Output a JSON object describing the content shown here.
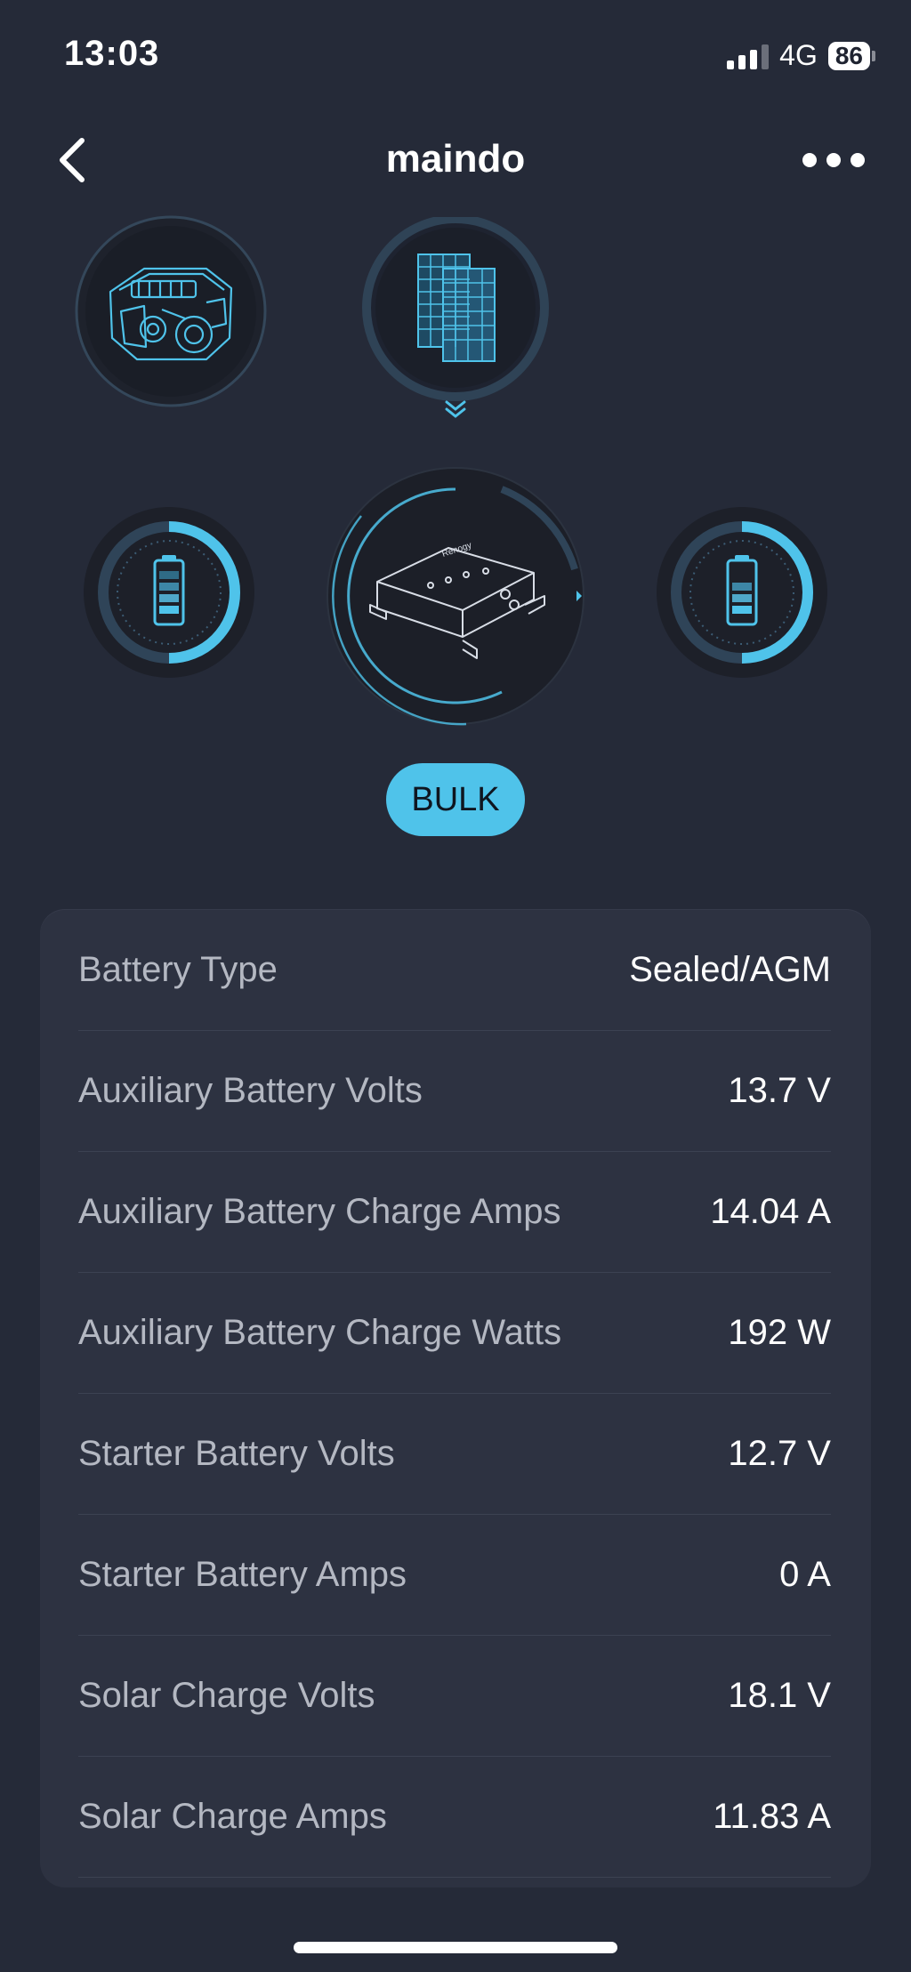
{
  "status_bar": {
    "time": "13:03",
    "network": "4G",
    "battery_level": "86"
  },
  "nav": {
    "title": "maindo"
  },
  "diagram": {
    "engine_icon": "engine-icon",
    "solar_icon": "solar-panel-icon",
    "charger_icon": "dc-dc-charger-icon",
    "aux_battery_icon": "battery-icon",
    "starter_battery_icon": "battery-icon",
    "accent_color": "#4fc3ea"
  },
  "charge_stage": "BULK",
  "info": {
    "rows": [
      {
        "label": "Battery Type",
        "value": "Sealed/AGM"
      },
      {
        "label": "Auxiliary Battery Volts",
        "value": "13.7 V"
      },
      {
        "label": "Auxiliary Battery Charge Amps",
        "value": "14.04 A"
      },
      {
        "label": "Auxiliary Battery Charge Watts",
        "value": "192 W"
      },
      {
        "label": "Starter Battery Volts",
        "value": "12.7 V"
      },
      {
        "label": "Starter Battery Amps",
        "value": "0 A"
      },
      {
        "label": "Solar Charge Volts",
        "value": "18.1 V"
      },
      {
        "label": "Solar Charge Amps",
        "value": "11.83 A"
      }
    ]
  }
}
